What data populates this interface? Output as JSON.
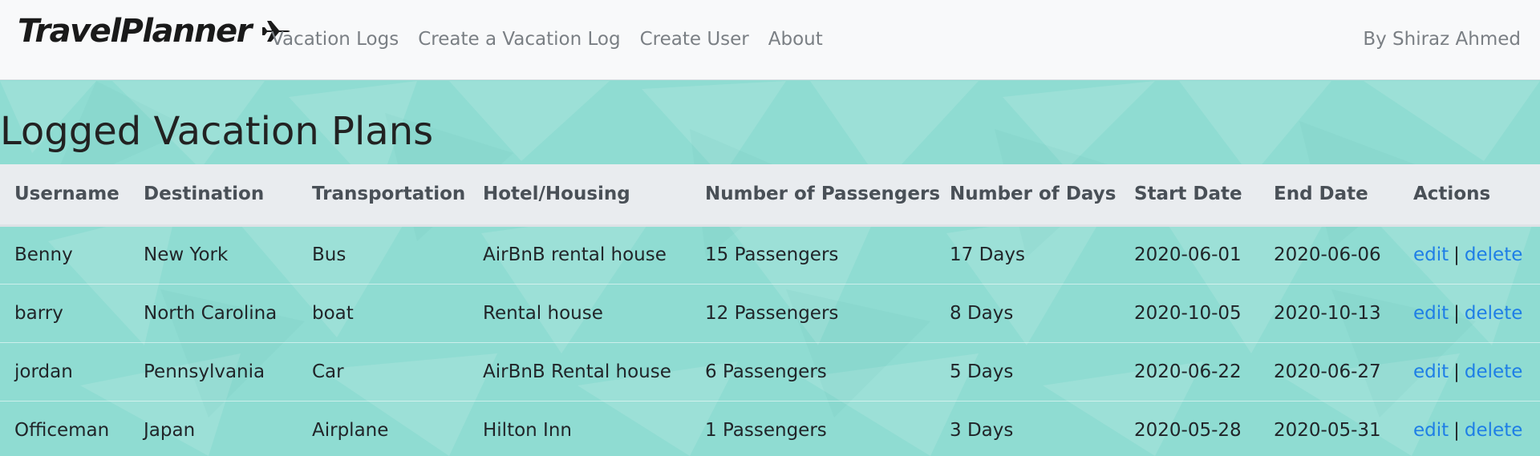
{
  "navbar": {
    "brand": "TravelPlanner",
    "brand_icon": "airplane-icon",
    "links": [
      "Vacation Logs",
      "Create a Vacation Log",
      "Create User",
      "About"
    ],
    "author": "By Shiraz Ahmed"
  },
  "page": {
    "title": "Logged Vacation Plans",
    "background_color": "#8fdcd2"
  },
  "table": {
    "headers": [
      "Username",
      "Destination",
      "Transportation",
      "Hotel/Housing",
      "Number of Passengers",
      "Number of Days",
      "Start Date",
      "End Date",
      "Actions"
    ],
    "rows": [
      {
        "username": "Benny",
        "destination": "New York",
        "transportation": "Bus",
        "housing": "AirBnB rental house",
        "passengers": "15 Passengers",
        "days": "17 Days",
        "start": "2020-06-01",
        "end": "2020-06-06",
        "edit": "edit",
        "sep": "|",
        "delete": "delete"
      },
      {
        "username": "barry",
        "destination": "North Carolina",
        "transportation": "boat",
        "housing": "Rental house",
        "passengers": "12 Passengers",
        "days": "8 Days",
        "start": "2020-10-05",
        "end": "2020-10-13",
        "edit": "edit",
        "sep": "|",
        "delete": "delete"
      },
      {
        "username": "jordan",
        "destination": "Pennsylvania",
        "transportation": "Car",
        "housing": "AirBnB Rental house",
        "passengers": "6 Passengers",
        "days": "5 Days",
        "start": "2020-06-22",
        "end": "2020-06-27",
        "edit": "edit",
        "sep": "|",
        "delete": "delete"
      },
      {
        "username": "Officeman",
        "destination": "Japan",
        "transportation": "Airplane",
        "housing": "Hilton Inn",
        "passengers": "1 Passengers",
        "days": "3 Days",
        "start": "2020-05-28",
        "end": "2020-05-31",
        "edit": "edit",
        "sep": "|",
        "delete": "delete"
      }
    ]
  },
  "colors": {
    "link": "#1e7ee6",
    "navbar_bg": "#f8f9fa",
    "header_bg": "#e9ecef"
  }
}
